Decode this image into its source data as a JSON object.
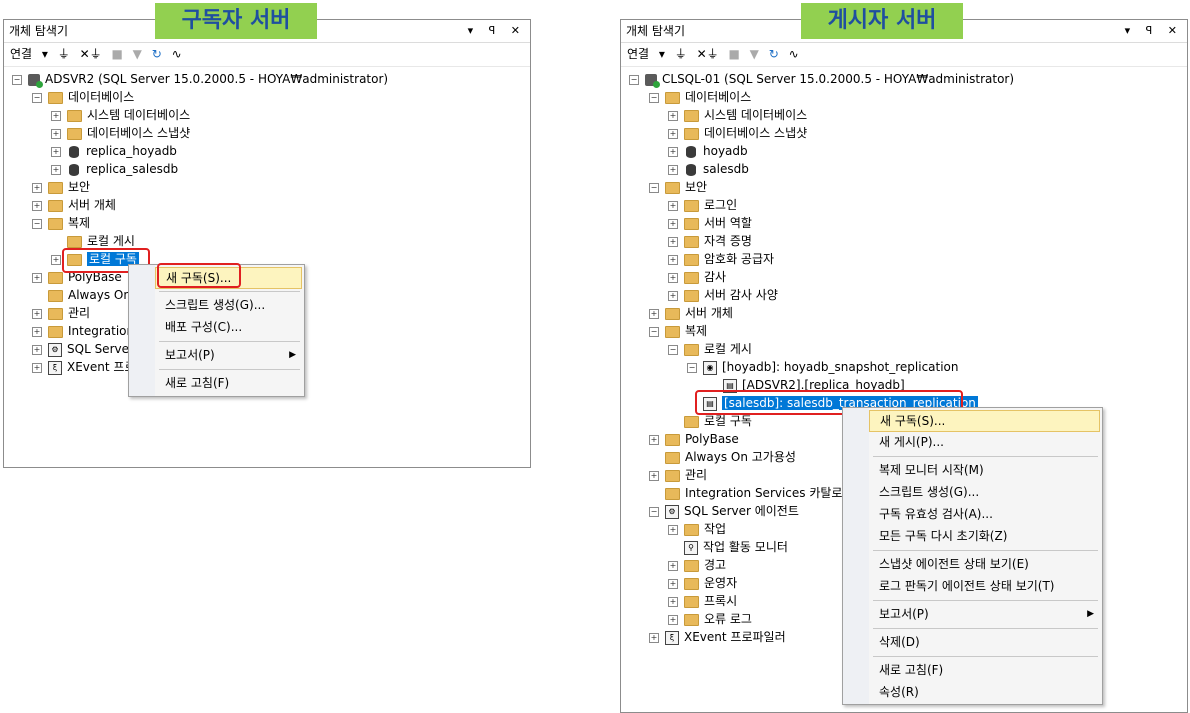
{
  "left": {
    "title": "개체 탐색기",
    "label": "구독자 서버",
    "toolbar_connect": "연결",
    "tree": [
      {
        "label": "ADSVR2 (SQL Server 15.0.2000.5 - HOYA₩administrator)"
      },
      {
        "label": "데이터베이스"
      },
      {
        "label": "시스템 데이터베이스"
      },
      {
        "label": "데이터베이스 스냅샷"
      },
      {
        "label": "replica_hoyadb"
      },
      {
        "label": "replica_salesdb"
      },
      {
        "label": "보안"
      },
      {
        "label": "서버 개체"
      },
      {
        "label": "복제"
      },
      {
        "label": "로컬 게시"
      },
      {
        "label": "로컬 구독"
      },
      {
        "label": "PolyBase"
      },
      {
        "label": "Always On"
      },
      {
        "label": "관리"
      },
      {
        "label": "Integration"
      },
      {
        "label": "SQL Server"
      },
      {
        "label": "XEvent 프로"
      }
    ],
    "menu": [
      {
        "label": "새 구독(S)..."
      },
      {
        "label": "스크립트 생성(G)..."
      },
      {
        "label": "배포 구성(C)..."
      },
      {
        "label": "보고서(P)"
      },
      {
        "label": "새로 고침(F)"
      }
    ]
  },
  "right": {
    "title": "개체 탐색기",
    "label": "게시자 서버",
    "toolbar_connect": "연결",
    "tree": [
      {
        "label": "CLSQL-01 (SQL Server 15.0.2000.5 - HOYA₩administrator)"
      },
      {
        "label": "데이터베이스"
      },
      {
        "label": "시스템 데이터베이스"
      },
      {
        "label": "데이터베이스 스냅샷"
      },
      {
        "label": "hoyadb"
      },
      {
        "label": "salesdb"
      },
      {
        "label": "보안"
      },
      {
        "label": "로그인"
      },
      {
        "label": "서버 역할"
      },
      {
        "label": "자격 증명"
      },
      {
        "label": "암호화 공급자"
      },
      {
        "label": "감사"
      },
      {
        "label": "서버 감사 사양"
      },
      {
        "label": "서버 개체"
      },
      {
        "label": "복제"
      },
      {
        "label": "로컬 게시"
      },
      {
        "label": "[hoyadb]: hoyadb_snapshot_replication"
      },
      {
        "label": "[ADSVR2].[replica_hoyadb]"
      },
      {
        "label": "[salesdb]: salesdb_transaction_replication"
      },
      {
        "label": "로컬 구독"
      },
      {
        "label": "PolyBase"
      },
      {
        "label": "Always On 고가용성"
      },
      {
        "label": "관리"
      },
      {
        "label": "Integration Services 카탈로그"
      },
      {
        "label": "SQL Server 에이전트"
      },
      {
        "label": "작업"
      },
      {
        "label": "작업 활동 모니터"
      },
      {
        "label": "경고"
      },
      {
        "label": "운영자"
      },
      {
        "label": "프록시"
      },
      {
        "label": "오류 로그"
      },
      {
        "label": "XEvent 프로파일러"
      }
    ],
    "menu": [
      {
        "label": "새 구독(S)..."
      },
      {
        "label": "새 게시(P)..."
      },
      {
        "label": "복제 모니터 시작(M)"
      },
      {
        "label": "스크립트 생성(G)..."
      },
      {
        "label": "구독 유효성 검사(A)..."
      },
      {
        "label": "모든 구독 다시 초기화(Z)"
      },
      {
        "label": "스냅샷 에이전트 상태 보기(E)"
      },
      {
        "label": "로그 판독기 에이전트 상태 보기(T)"
      },
      {
        "label": "보고서(P)"
      },
      {
        "label": "삭제(D)"
      },
      {
        "label": "새로 고침(F)"
      },
      {
        "label": "속성(R)"
      }
    ]
  }
}
